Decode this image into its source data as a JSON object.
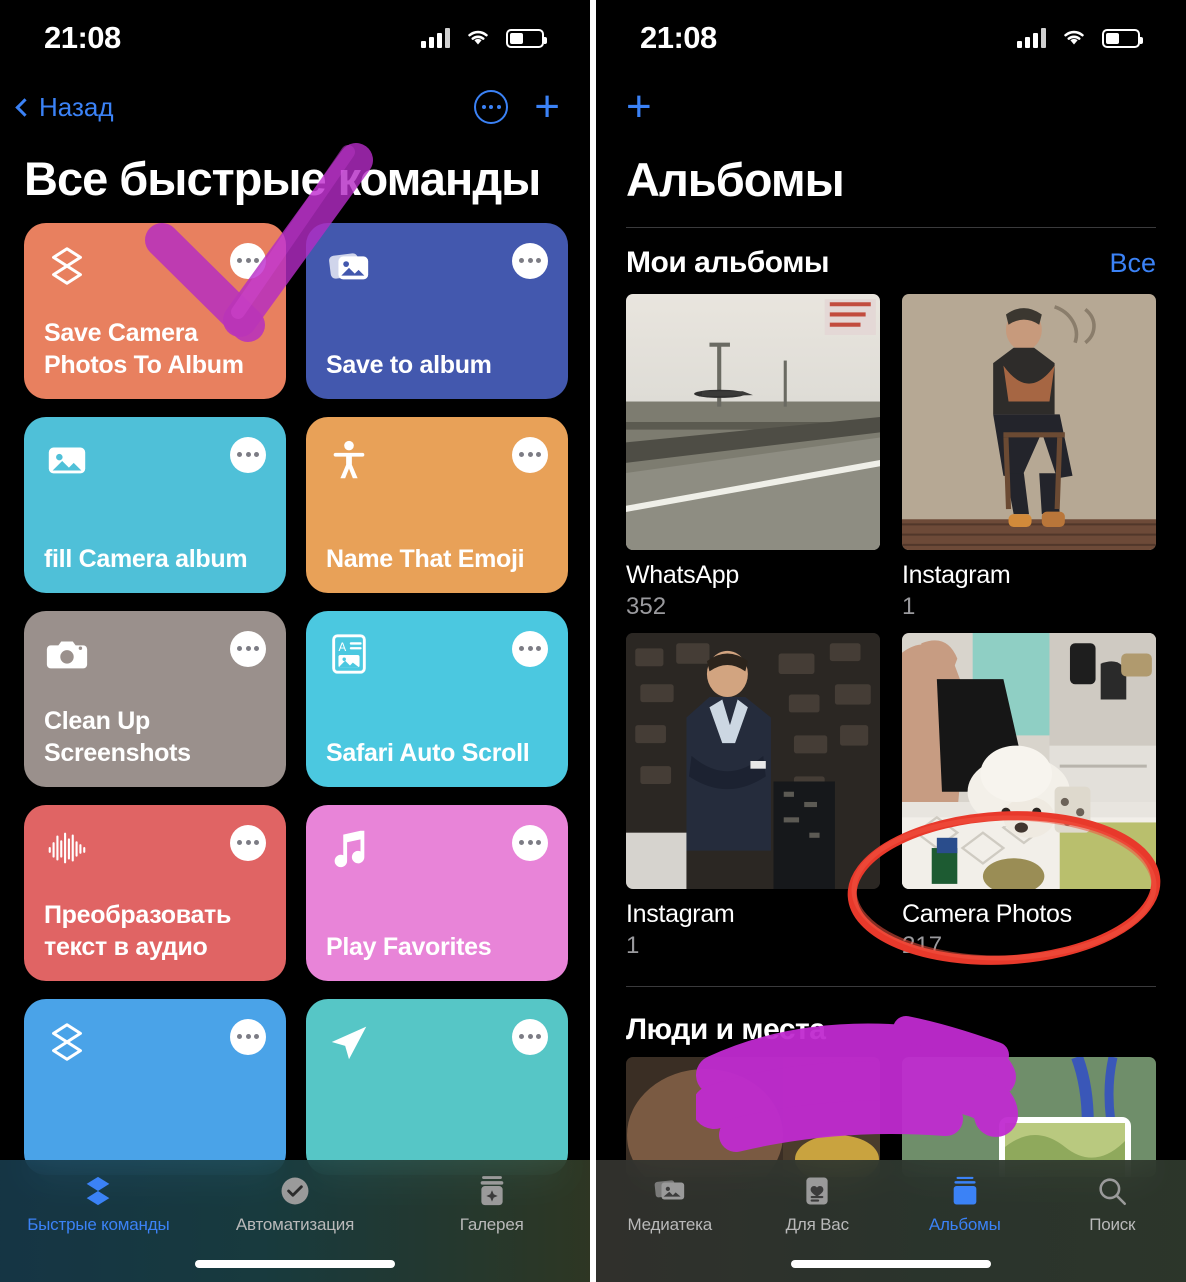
{
  "status_bar": {
    "time": "21:08",
    "cellular_icon": "signal-bars-icon",
    "wifi_icon": "wifi-icon",
    "battery_icon": "battery-icon"
  },
  "shortcuts_screen": {
    "nav": {
      "back_label": "Назад",
      "back_icon": "chevron-left-icon",
      "more_icon": "more-circle-icon",
      "add_icon": "plus-icon"
    },
    "title": "Все быстрые команды",
    "tiles": [
      {
        "label": "Save Camera Photos To Album",
        "color": "#E8805F",
        "icon": "layers-icon",
        "more_icon": "more-icon"
      },
      {
        "label": "Save to album",
        "color": "#4358AE",
        "icon": "photo-stack-icon",
        "more_icon": "more-icon"
      },
      {
        "label": "fill Camera album",
        "color": "#4FC0D8",
        "icon": "photo-icon",
        "more_icon": "more-icon"
      },
      {
        "label": "Name That Emoji",
        "color": "#E8A158",
        "icon": "accessibility-icon",
        "more_icon": "more-icon"
      },
      {
        "label": "Clean Up Screenshots",
        "color": "#9A908C",
        "icon": "camera-icon",
        "more_icon": "more-icon"
      },
      {
        "label": "Safari Auto Scroll",
        "color": "#4BC8E0",
        "icon": "text-image-card-icon",
        "more_icon": "more-icon"
      },
      {
        "label": "Преобразовать текст в аудио",
        "color": "#E06464",
        "icon": "waveform-icon",
        "more_icon": "more-icon"
      },
      {
        "label": "Play Favorites",
        "color": "#E884D8",
        "icon": "music-note-icon",
        "more_icon": "more-icon"
      },
      {
        "label": "",
        "color": "#4AA3E8",
        "icon": "layers-icon",
        "more_icon": "more-icon"
      },
      {
        "label": "",
        "color": "#56C6C6",
        "icon": "paper-plane-icon",
        "more_icon": "more-icon"
      }
    ],
    "tabs": [
      {
        "label": "Быстрые команды",
        "icon": "layers-icon",
        "active": true
      },
      {
        "label": "Автоматизация",
        "icon": "clock-check-icon",
        "active": false
      },
      {
        "label": "Галерея",
        "icon": "gallery-sparkle-icon",
        "active": false
      }
    ]
  },
  "photos_screen": {
    "nav": {
      "add_icon": "plus-icon"
    },
    "title": "Альбомы",
    "my_albums": {
      "section_title": "Мои альбомы",
      "see_all_label": "Все",
      "albums": [
        {
          "name": "WhatsApp",
          "count": "352",
          "thumb": "road-airplane-photo"
        },
        {
          "name": "Instagram",
          "count": "1",
          "thumb": "man-on-chair-photo"
        },
        {
          "name": "Instagram",
          "count": "1",
          "thumb": "man-in-suit-photo"
        },
        {
          "name": "Camera Photos",
          "count": "217",
          "thumb": "dog-on-table-photo"
        }
      ]
    },
    "people_places": {
      "section_title": "Люди и места",
      "items": [
        {
          "thumb": "person-photo"
        },
        {
          "thumb": "map-photo"
        }
      ]
    },
    "tabs": [
      {
        "label": "Медиатека",
        "icon": "photo-stack-icon",
        "active": false
      },
      {
        "label": "Для Вас",
        "icon": "memories-card-icon",
        "active": false
      },
      {
        "label": "Альбомы",
        "icon": "albums-stack-icon",
        "active": true
      },
      {
        "label": "Поиск",
        "icon": "search-icon",
        "active": false
      }
    ]
  },
  "annotations": [
    {
      "type": "purple-arrow",
      "target": "Save Camera Photos To Album tile",
      "color": "#B42BC4"
    },
    {
      "type": "red-circle",
      "target": "Camera Photos album",
      "color": "#E8392B"
    },
    {
      "type": "purple-scribble",
      "target": "Люди и места thumbnail",
      "color": "#C02BD0"
    }
  ],
  "colors": {
    "accent_blue": "#3B82F6",
    "background": "#000000",
    "marker_purple": "#B42BC4",
    "marker_red": "#E8392B"
  }
}
